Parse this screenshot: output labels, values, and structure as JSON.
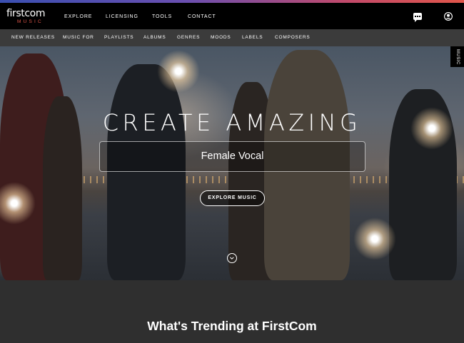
{
  "brand": {
    "name": "firstcom",
    "tagline": "MUSIC",
    "accent_color": "#e0564a"
  },
  "topnav": {
    "items": [
      {
        "label": "EXPLORE"
      },
      {
        "label": "LICENSING"
      },
      {
        "label": "TOOLS"
      },
      {
        "label": "CONTACT"
      }
    ],
    "icons": [
      "chat-icon",
      "account-icon"
    ]
  },
  "subnav": {
    "items": [
      {
        "label": "NEW RELEASES"
      },
      {
        "label": "MUSIC FOR"
      },
      {
        "label": "PLAYLISTS"
      },
      {
        "label": "ALBUMS"
      },
      {
        "label": "GENRES"
      },
      {
        "label": "MOODS"
      },
      {
        "label": "LABELS"
      },
      {
        "label": "COMPOSERS"
      }
    ]
  },
  "side_tab": {
    "label": "MUSIC"
  },
  "hero": {
    "title": "CREATE AMAZING",
    "genre": "Female Vocal",
    "cta_label": "EXPLORE MUSIC",
    "scroll_icon": "chevron-down-icon"
  },
  "trending": {
    "title": "What's Trending at FirstCom"
  }
}
